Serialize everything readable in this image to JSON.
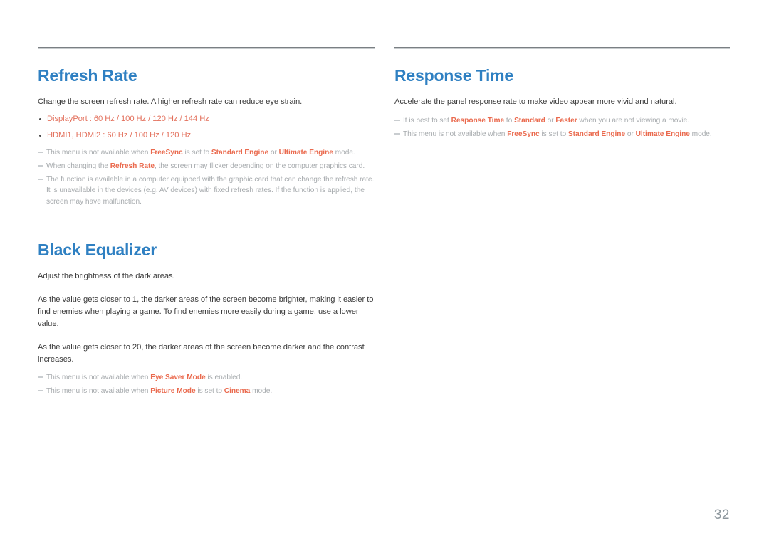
{
  "page": {
    "number": "32",
    "heading_color": "#2f80c2",
    "bullet_color": "#e3705c",
    "note_color": "#a7abae",
    "note_highlight_color": "#ea6a4e",
    "body_color": "#3b3b3b",
    "rule_color": "#7a7f83"
  },
  "left_column": {
    "sections": [
      {
        "id": "refresh-rate",
        "title": "Refresh Rate",
        "intro": "Change the screen refresh rate. A higher refresh rate can reduce eye strain.",
        "bullets": [
          "DisplayPort : 60 Hz / 100 Hz / 120 Hz / 144 Hz",
          "HDMI1, HDMI2 : 60 Hz / 100 Hz / 120 Hz"
        ],
        "notes": [
          "This menu is not available when <b>FreeSync</b> is set to <b>Standard Engine</b> or <b>Ultimate Engine</b> mode.",
          "When changing the <b>Refresh Rate</b>, the screen may flicker depending on the computer graphics card.",
          "The function is available in a computer equipped with the graphic card that can change the refresh rate. It is unavailable in the devices (e.g. AV devices) with fixed refresh rates. If the function is applied, the screen may have malfunction."
        ]
      },
      {
        "id": "black-equalizer",
        "title": "Black Equalizer",
        "intro": "Adjust the brightness of the dark areas.",
        "paragraphs": [
          "As the value gets closer to 1, the darker areas of the screen become brighter, making it easier to find enemies when playing a game. To find enemies more easily during a game, use a lower value.",
          "As the value gets closer to 20, the darker areas of the screen become darker and the contrast increases."
        ],
        "notes": [
          "This menu is not available when <b>Eye Saver Mode</b> is enabled.",
          "This menu is not available when <b>Picture Mode</b> is set to <b>Cinema</b> mode."
        ]
      }
    ]
  },
  "right_column": {
    "sections": [
      {
        "id": "response-time",
        "title": "Response Time",
        "intro": "Accelerate the panel response rate to make video appear more vivid and natural.",
        "notes": [
          "It is best to set <b>Response Time</b> to <b>Standard</b> or <b>Faster</b> when you are not viewing a movie.",
          "This menu is not available when <b>FreeSync</b> is set to <b>Standard Engine</b> or <b>Ultimate Engine</b> mode."
        ]
      }
    ]
  }
}
